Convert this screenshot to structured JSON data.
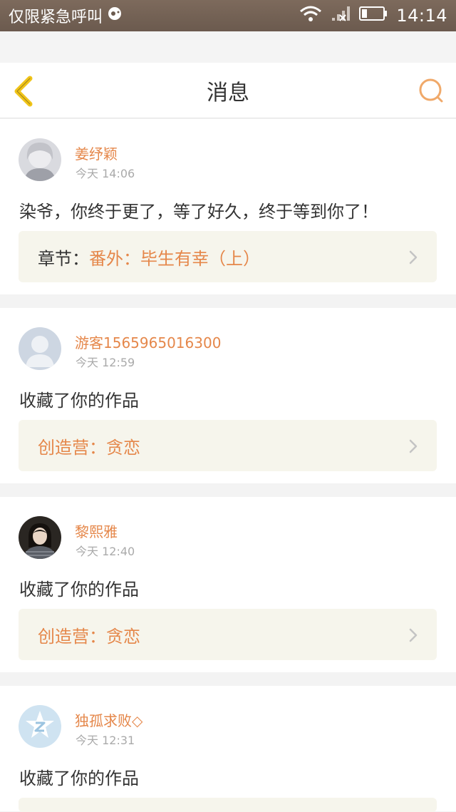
{
  "status_bar": {
    "carrier_text": "仅限紧急呼叫",
    "time": "14:14",
    "icons": [
      "notification-icon",
      "wifi-icon",
      "signal-icon",
      "battery-icon"
    ]
  },
  "header": {
    "title": "消息",
    "back_icon": "chevron-left-icon",
    "search_icon": "search-icon",
    "accent_color": "#e5874a",
    "back_color": "#f0c419"
  },
  "messages": [
    {
      "name": "姜纾颖",
      "time": "今天 14:06",
      "content": "染爷，你终于更了，等了好久，终于等到你了！",
      "link_label": "章节：",
      "link_value": "番外：毕生有幸（上）"
    },
    {
      "name": "游客1565965016300",
      "time": "今天 12:59",
      "content": "收藏了你的作品",
      "link_label": "创造营：",
      "link_value": "贪恋"
    },
    {
      "name": "黎熙雅",
      "time": "今天 12:40",
      "content": "收藏了你的作品",
      "link_label": "创造营：",
      "link_value": "贪恋"
    },
    {
      "name": "独孤求败◇",
      "time": "今天 12:31",
      "content": "收藏了你的作品"
    }
  ]
}
